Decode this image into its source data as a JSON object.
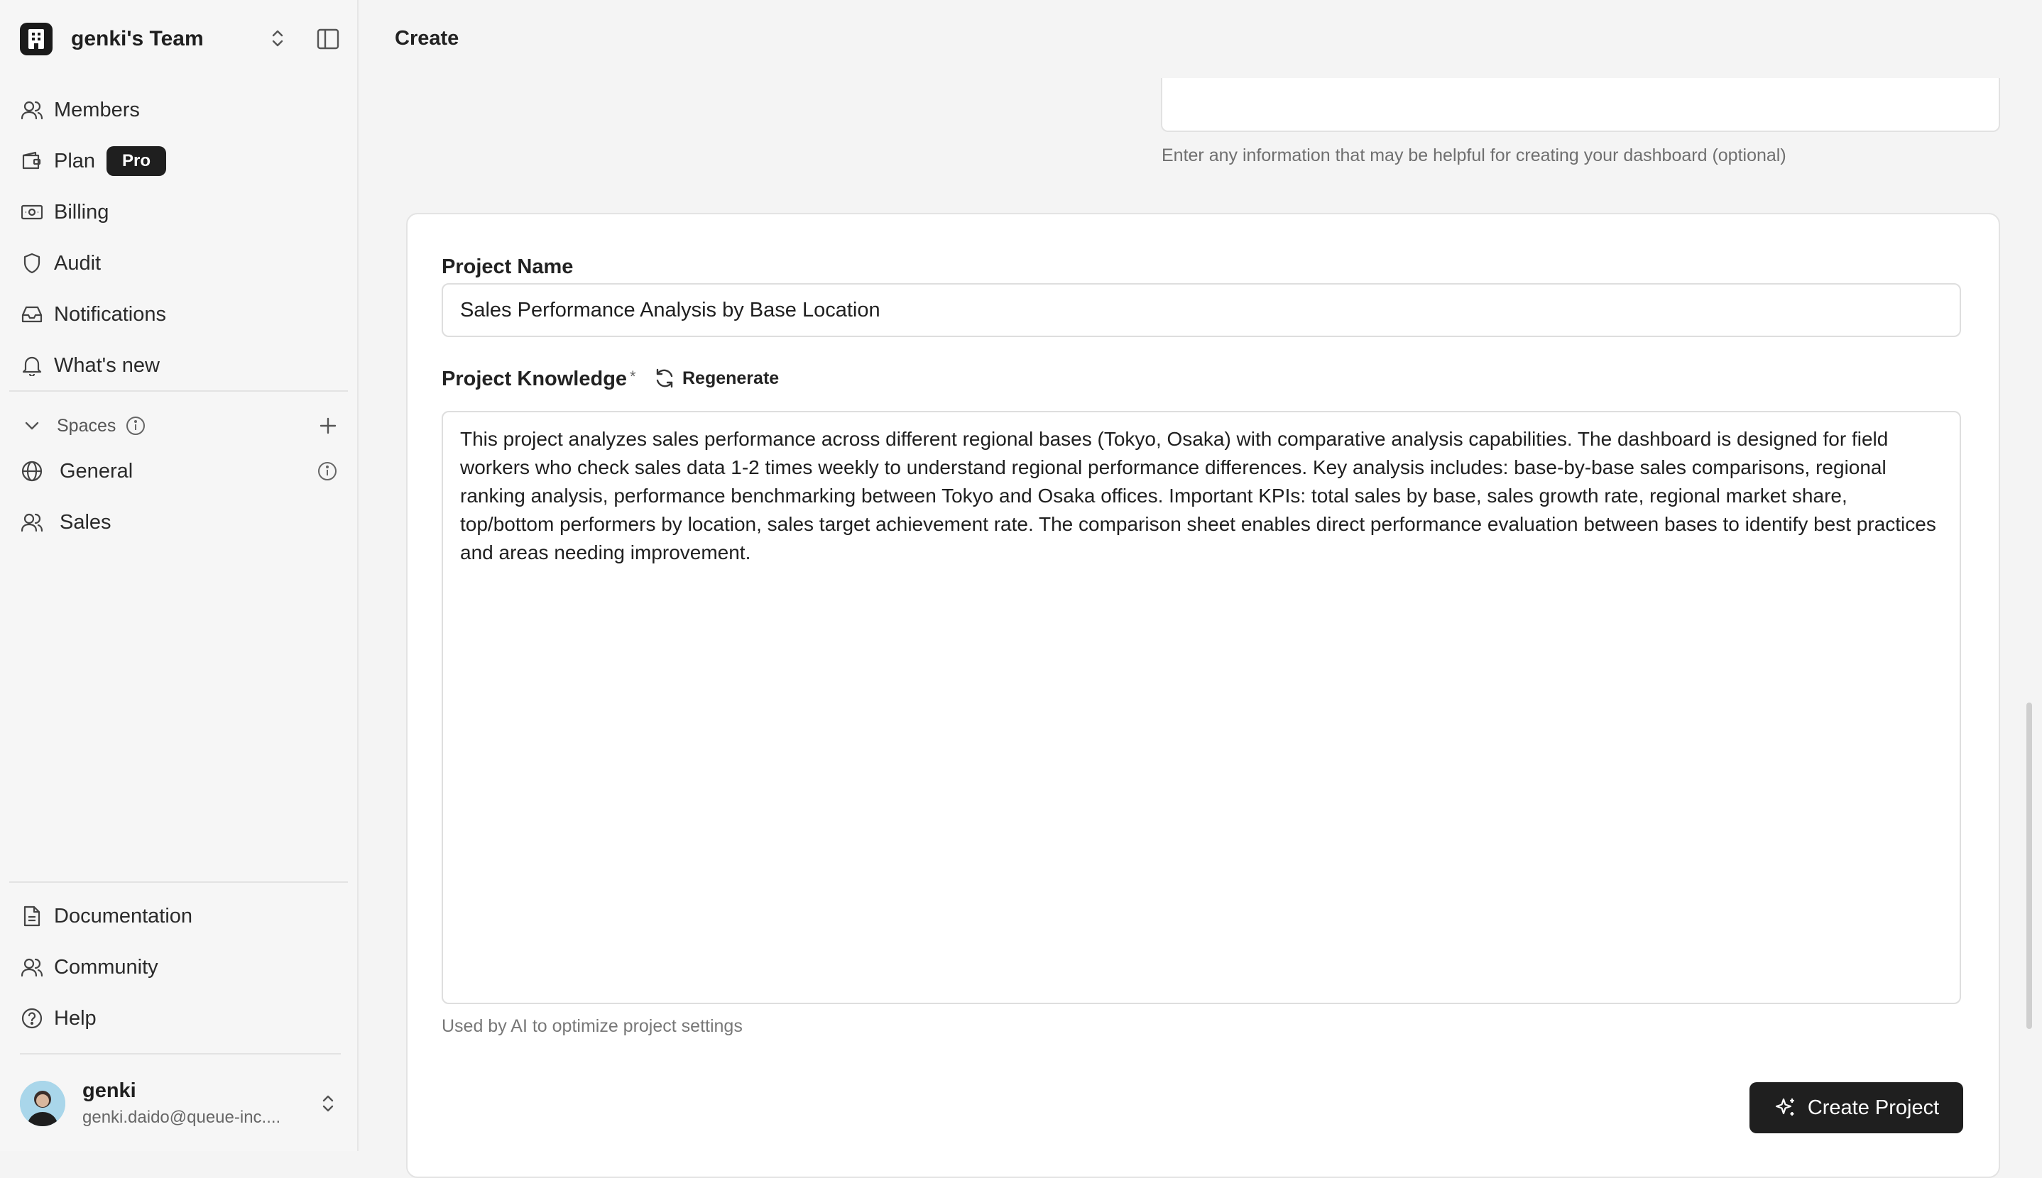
{
  "team": {
    "name": "genki's Team"
  },
  "nav": {
    "members": "Members",
    "plan": "Plan",
    "plan_badge": "Pro",
    "billing": "Billing",
    "audit": "Audit",
    "notifications": "Notifications",
    "whats_new": "What's new"
  },
  "spaces": {
    "heading": "Spaces",
    "items": [
      {
        "label": "General"
      },
      {
        "label": "Sales"
      }
    ]
  },
  "bottom_nav": {
    "documentation": "Documentation",
    "community": "Community",
    "help": "Help"
  },
  "user": {
    "name": "genki",
    "email": "genki.daido@queue-inc...."
  },
  "header": {
    "title": "Create"
  },
  "additional_info": {
    "hint": "Enter any information that may be helpful for creating your dashboard (optional)"
  },
  "form": {
    "project_name_label": "Project Name",
    "project_name_value": "Sales Performance Analysis by Base Location",
    "knowledge_label": "Project Knowledge",
    "required_mark": "*",
    "regenerate_label": "Regenerate",
    "knowledge_value": "This project analyzes sales performance across different regional bases (Tokyo, Osaka) with comparative analysis capabilities. The dashboard is designed for field workers who check sales data 1-2 times weekly to understand regional performance differences. Key analysis includes: base-by-base sales comparisons, regional ranking analysis, performance benchmarking between Tokyo and Osaka offices. Important KPIs: total sales by base, sales growth rate, regional market share, top/bottom performers by location, sales target achievement rate. The comparison sheet enables direct performance evaluation between bases to identify best practices and areas needing improvement.",
    "knowledge_hint": "Used by AI to optimize project settings",
    "create_button": "Create Project"
  }
}
